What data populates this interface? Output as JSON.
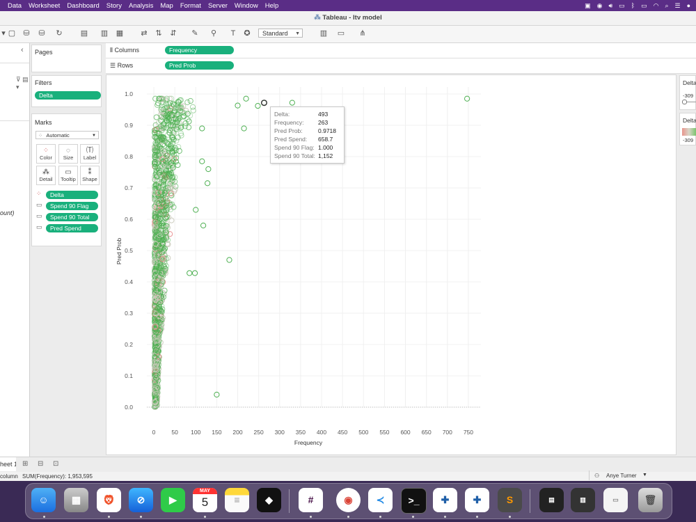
{
  "menubar": {
    "items": [
      "Data",
      "Worksheet",
      "Dashboard",
      "Story",
      "Analysis",
      "Map",
      "Format",
      "Server",
      "Window",
      "Help"
    ]
  },
  "window": {
    "title": "Tableau - ltv model"
  },
  "toolbar": {
    "mark_size_dropdown": "Standard"
  },
  "cards": {
    "pages_title": "Pages",
    "filters_title": "Filters",
    "filter_pills": [
      "Delta"
    ],
    "marks_title": "Marks",
    "mark_type": "Automatic",
    "mark_buttons": [
      "Color",
      "Size",
      "Label",
      "Detail",
      "Tooltip",
      "Shape"
    ],
    "mark_pills": [
      "Delta",
      "Spend 90 Flag",
      "Spend 90 Total",
      "Pred Spend"
    ]
  },
  "datapane": {
    "partial_text": "ount)"
  },
  "shelves": {
    "columns_label": "Columns",
    "columns_pill": "Frequency",
    "rows_label": "Rows",
    "rows_pill": "Pred Prob"
  },
  "chart_data": {
    "type": "scatter",
    "xlabel": "Frequency",
    "ylabel": "Pred Prob",
    "xlim": [
      0,
      780
    ],
    "ylim": [
      0,
      1.0
    ],
    "x_ticks": [
      0,
      50,
      100,
      150,
      200,
      250,
      300,
      350,
      400,
      450,
      500,
      550,
      600,
      650,
      700,
      750
    ],
    "y_ticks": [
      "0.0",
      "0.1",
      "0.2",
      "0.3",
      "0.4",
      "0.5",
      "0.6",
      "0.7",
      "0.8",
      "0.9",
      "1.0"
    ],
    "color_by": "Delta",
    "colors": {
      "positive": "#4caf50",
      "neutral": "#c9c9b9",
      "negative": "#e88a8a"
    },
    "highlighted_point": {
      "x": 263,
      "y": 0.9718
    },
    "outlier_points": [
      {
        "x": 747,
        "y": 0.985
      },
      {
        "x": 330,
        "y": 0.972
      },
      {
        "x": 263,
        "y": 0.9718
      },
      {
        "x": 248,
        "y": 0.962
      },
      {
        "x": 220,
        "y": 0.985
      },
      {
        "x": 200,
        "y": 0.963
      },
      {
        "x": 215,
        "y": 0.89
      },
      {
        "x": 180,
        "y": 0.47
      },
      {
        "x": 150,
        "y": 0.04
      },
      {
        "x": 130,
        "y": 0.76
      },
      {
        "x": 128,
        "y": 0.715
      },
      {
        "x": 118,
        "y": 0.58
      },
      {
        "x": 115,
        "y": 0.785
      },
      {
        "x": 115,
        "y": 0.89
      },
      {
        "x": 85,
        "y": 0.428
      },
      {
        "x": 98,
        "y": 0.428
      },
      {
        "x": 100,
        "y": 0.63
      }
    ]
  },
  "tooltip": {
    "rows": [
      {
        "k": "Delta:",
        "v": "493"
      },
      {
        "k": "Frequency:",
        "v": "263"
      },
      {
        "k": "Pred Prob:",
        "v": "0.9718"
      },
      {
        "k": "Pred Spend:",
        "v": "658.7"
      },
      {
        "k": "Spend 90 Flag:",
        "v": "1.000"
      },
      {
        "k": "Spend 90 Total:",
        "v": "1,152"
      }
    ]
  },
  "rightpane": {
    "delta_label_1": "Delta",
    "delta_value_1": "-309",
    "delta_label_2": "Delta",
    "delta_value_2": "-309"
  },
  "sheettabs": {
    "current_sheet": "heet 1"
  },
  "statusbar": {
    "left_text": "column",
    "summary": "SUM(Frequency): 1,953,595",
    "user": "Anye Turner"
  },
  "dock": {
    "calendar_month": "MAY",
    "calendar_day": "5",
    "apps": [
      "finder",
      "launchpad",
      "brave",
      "safari",
      "facetime",
      "calendar",
      "notes",
      "tidal",
      "slack",
      "chrome",
      "vscode",
      "terminal",
      "tableau",
      "tableau",
      "sublime",
      "trash"
    ]
  }
}
